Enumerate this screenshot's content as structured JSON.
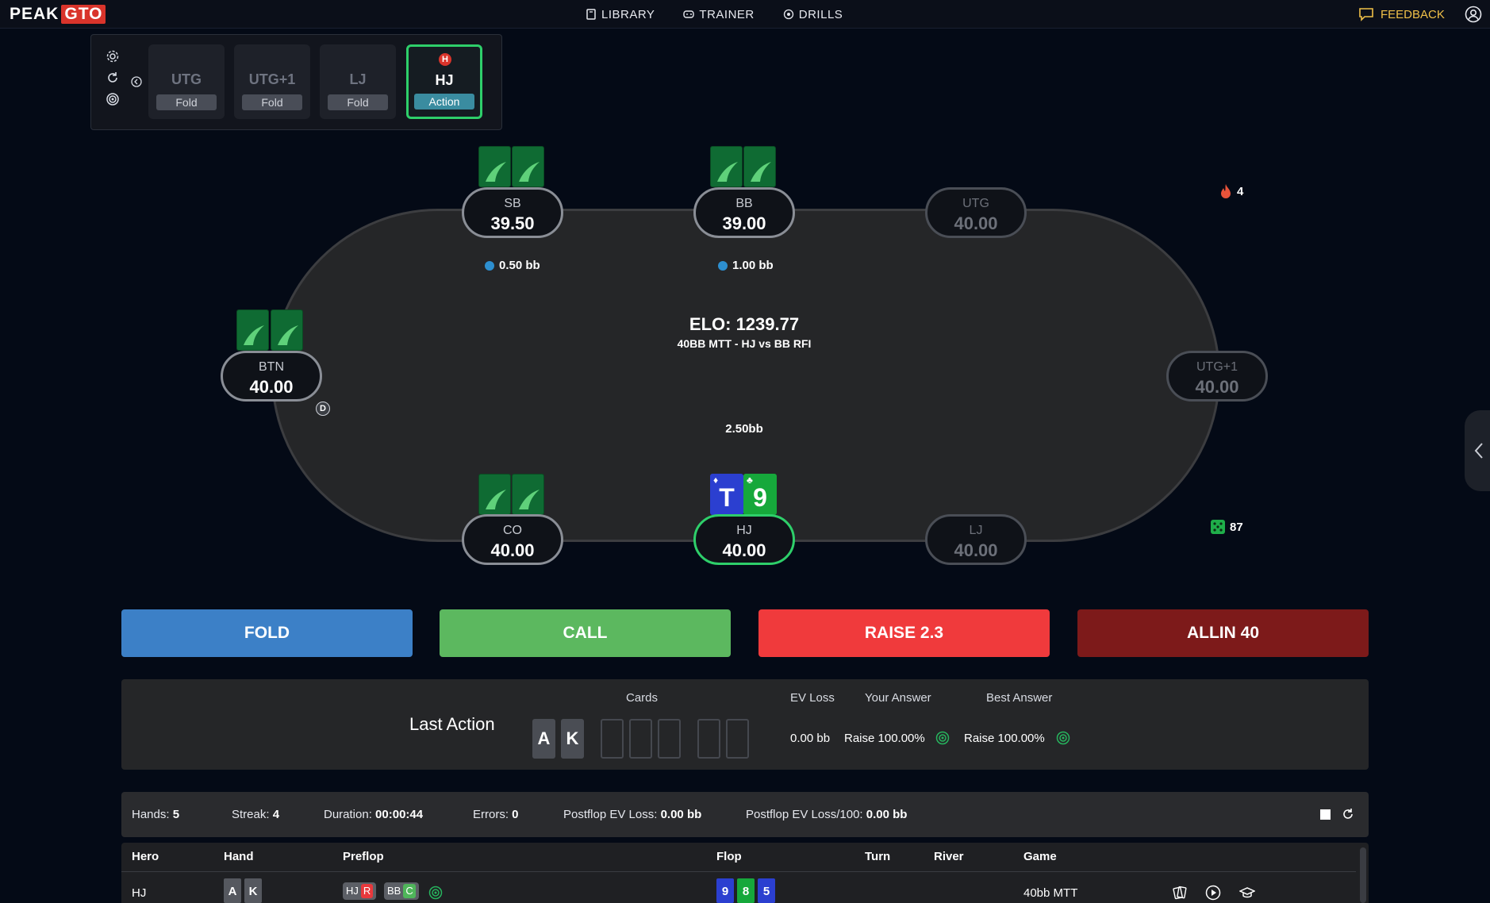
{
  "nav": {
    "logo_left": "PEAK",
    "logo_right": "GTO",
    "links": [
      {
        "label": "LIBRARY",
        "icon": "book-icon"
      },
      {
        "label": "TRAINER",
        "icon": "gamepad-icon"
      },
      {
        "label": "DRILLS",
        "icon": "target-icon"
      }
    ],
    "feedback": "FEEDBACK"
  },
  "position_panel": {
    "seats": [
      {
        "name": "UTG",
        "status": "Fold"
      },
      {
        "name": "UTG+1",
        "status": "Fold"
      },
      {
        "name": "LJ",
        "status": "Fold"
      },
      {
        "name": "HJ",
        "status": "Action",
        "badge": "H"
      }
    ]
  },
  "table": {
    "seats": {
      "sb": {
        "name": "SB",
        "stack": "39.50"
      },
      "bb": {
        "name": "BB",
        "stack": "39.00"
      },
      "utg": {
        "name": "UTG",
        "stack": "40.00"
      },
      "btn": {
        "name": "BTN",
        "stack": "40.00"
      },
      "utg1": {
        "name": "UTG+1",
        "stack": "40.00"
      },
      "co": {
        "name": "CO",
        "stack": "40.00"
      },
      "hj": {
        "name": "HJ",
        "stack": "40.00"
      },
      "lj": {
        "name": "LJ",
        "stack": "40.00"
      }
    },
    "blinds": {
      "sb": "0.50 bb",
      "bb": "1.00 bb"
    },
    "dealer": "D",
    "elo": "ELO: 1239.77",
    "scenario": "40BB MTT - HJ vs BB RFI",
    "pot": "2.50bb",
    "hero_cards": [
      {
        "rank": "T",
        "suit": "♦",
        "color": "#2b3fd0"
      },
      {
        "rank": "9",
        "suit": "♣",
        "color": "#16a83b"
      }
    ],
    "streak_count": "4",
    "dice_count": "87"
  },
  "actions": {
    "fold": "FOLD",
    "call": "CALL",
    "raise": "RAISE 2.3",
    "allin": "ALLIN 40"
  },
  "last_action": {
    "title": "Last Action",
    "headers": {
      "cards": "Cards",
      "ev_loss": "EV Loss",
      "your_answer": "Your Answer",
      "best_answer": "Best Answer"
    },
    "cards": [
      "A",
      "K"
    ],
    "ev_loss": "0.00 bb",
    "your_answer": "Raise 100.00%",
    "best_answer": "Raise 100.00%"
  },
  "stats": {
    "hands_label": "Hands:",
    "hands": "5",
    "streak_label": "Streak:",
    "streak": "4",
    "duration_label": "Duration:",
    "duration": "00:00:44",
    "errors_label": "Errors:",
    "errors": "0",
    "pev_label": "Postflop EV Loss:",
    "pev": "0.00 bb",
    "pev100_label": "Postflop EV Loss/100:",
    "pev100": "0.00 bb"
  },
  "history": {
    "headers": [
      "Hero",
      "Hand",
      "Preflop",
      "Flop",
      "Turn",
      "River",
      "Game"
    ],
    "row": {
      "hero": "HJ",
      "hand": [
        "A",
        "K"
      ],
      "preflop": [
        {
          "pos": "HJ",
          "act": "R"
        },
        {
          "pos": "BB",
          "act": "C"
        }
      ],
      "flop": [
        {
          "rank": "9",
          "color": "#2b3fd0"
        },
        {
          "rank": "8",
          "color": "#16a83b"
        },
        {
          "rank": "5",
          "color": "#2b3fd0"
        }
      ],
      "game": "40bb MTT"
    }
  }
}
